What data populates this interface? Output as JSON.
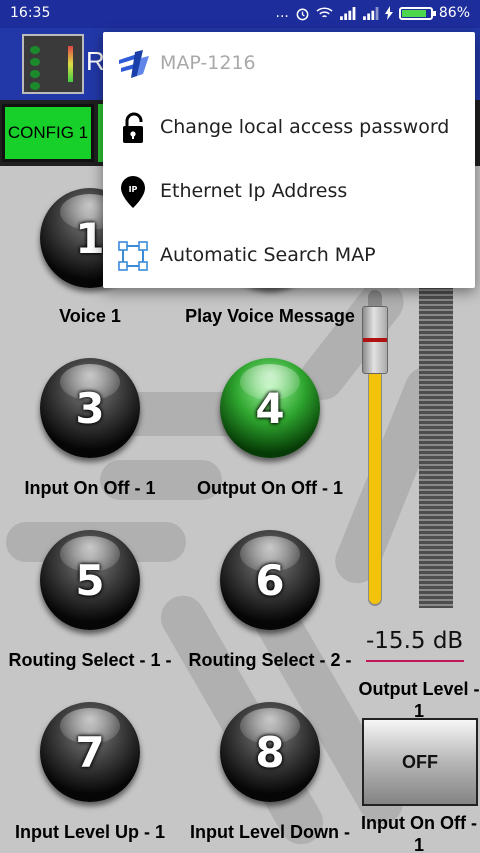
{
  "status_bar": {
    "time": "16:35",
    "dots": "...",
    "battery": "86%",
    "icons": [
      "alarm-icon",
      "wifi-icon",
      "signal-icon",
      "signal-icon",
      "charging-icon",
      "battery-icon"
    ]
  },
  "app_bar": {
    "title_visible": "R"
  },
  "tabs": {
    "config_label": "CONFIG 1"
  },
  "buttons": [
    {
      "number": "1",
      "label": "Voice 1",
      "color": "#111111"
    },
    {
      "number": "",
      "label": "Play Voice Message",
      "color": "#111111"
    },
    {
      "number": "3",
      "label": "Input On Off - 1",
      "color": "#111111"
    },
    {
      "number": "4",
      "label": "Output On Off - 1",
      "color": "#2ea52e"
    },
    {
      "number": "5",
      "label": "Routing Select - 1 -",
      "color": "#111111"
    },
    {
      "number": "6",
      "label": "Routing Select - 2 -",
      "color": "#111111"
    },
    {
      "number": "7",
      "label": "Input Level Up - 1",
      "color": "#111111"
    },
    {
      "number": "8",
      "label": "Input Level Down -",
      "color": "#111111"
    }
  ],
  "output": {
    "level_db": "-15.5 dB",
    "level_label": "Output Level - 1",
    "fader_level": 0.75,
    "fader_color": "#f3c20a"
  },
  "input_toggle": {
    "state": "OFF",
    "label": "Input On Off - 1"
  },
  "menu": {
    "items": [
      {
        "label": "MAP-1216",
        "icon": "brand-logo-icon",
        "enabled": false
      },
      {
        "label": "Change local access password",
        "icon": "lock-icon",
        "enabled": true
      },
      {
        "label": "Ethernet Ip Address",
        "icon": "ip-pin-icon",
        "enabled": true
      },
      {
        "label": "Automatic Search MAP",
        "icon": "network-search-icon",
        "enabled": true
      }
    ]
  }
}
